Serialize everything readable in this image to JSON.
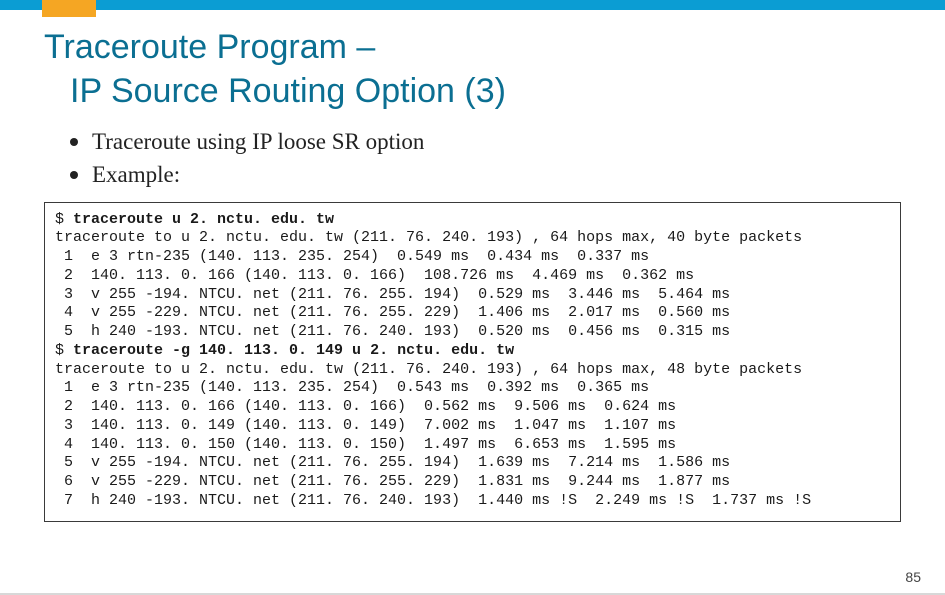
{
  "title": {
    "line1": "Traceroute Program –",
    "line2": "IP Source Routing Option (3)"
  },
  "bullets": [
    "Traceroute using IP loose SR option",
    "Example:"
  ],
  "code": {
    "cmd1_prefix": "$ ",
    "cmd1": "traceroute u 2. nctu. edu. tw",
    "run1_header": "traceroute to u 2. nctu. edu. tw (211. 76. 240. 193) , 64 hops max, 40 byte packets",
    "run1_hops": [
      " 1  e 3 rtn-235 (140. 113. 235. 254)  0.549 ms  0.434 ms  0.337 ms",
      " 2  140. 113. 0. 166 (140. 113. 0. 166)  108.726 ms  4.469 ms  0.362 ms",
      " 3  v 255 -194. NTCU. net (211. 76. 255. 194)  0.529 ms  3.446 ms  5.464 ms",
      " 4  v 255 -229. NTCU. net (211. 76. 255. 229)  1.406 ms  2.017 ms  0.560 ms",
      " 5  h 240 -193. NTCU. net (211. 76. 240. 193)  0.520 ms  0.456 ms  0.315 ms"
    ],
    "cmd2_prefix": "$ ",
    "cmd2": "traceroute -g 140. 113. 0. 149 u 2. nctu. edu. tw",
    "run2_header": "traceroute to u 2. nctu. edu. tw (211. 76. 240. 193) , 64 hops max, 48 byte packets",
    "run2_hops": [
      " 1  e 3 rtn-235 (140. 113. 235. 254)  0.543 ms  0.392 ms  0.365 ms",
      " 2  140. 113. 0. 166 (140. 113. 0. 166)  0.562 ms  9.506 ms  0.624 ms",
      " 3  140. 113. 0. 149 (140. 113. 0. 149)  7.002 ms  1.047 ms  1.107 ms",
      " 4  140. 113. 0. 150 (140. 113. 0. 150)  1.497 ms  6.653 ms  1.595 ms",
      " 5  v 255 -194. NTCU. net (211. 76. 255. 194)  1.639 ms  7.214 ms  1.586 ms",
      " 6  v 255 -229. NTCU. net (211. 76. 255. 229)  1.831 ms  9.244 ms  1.877 ms",
      " 7  h 240 -193. NTCU. net (211. 76. 240. 193)  1.440 ms !S  2.249 ms !S  1.737 ms !S"
    ]
  },
  "page_number": "85"
}
